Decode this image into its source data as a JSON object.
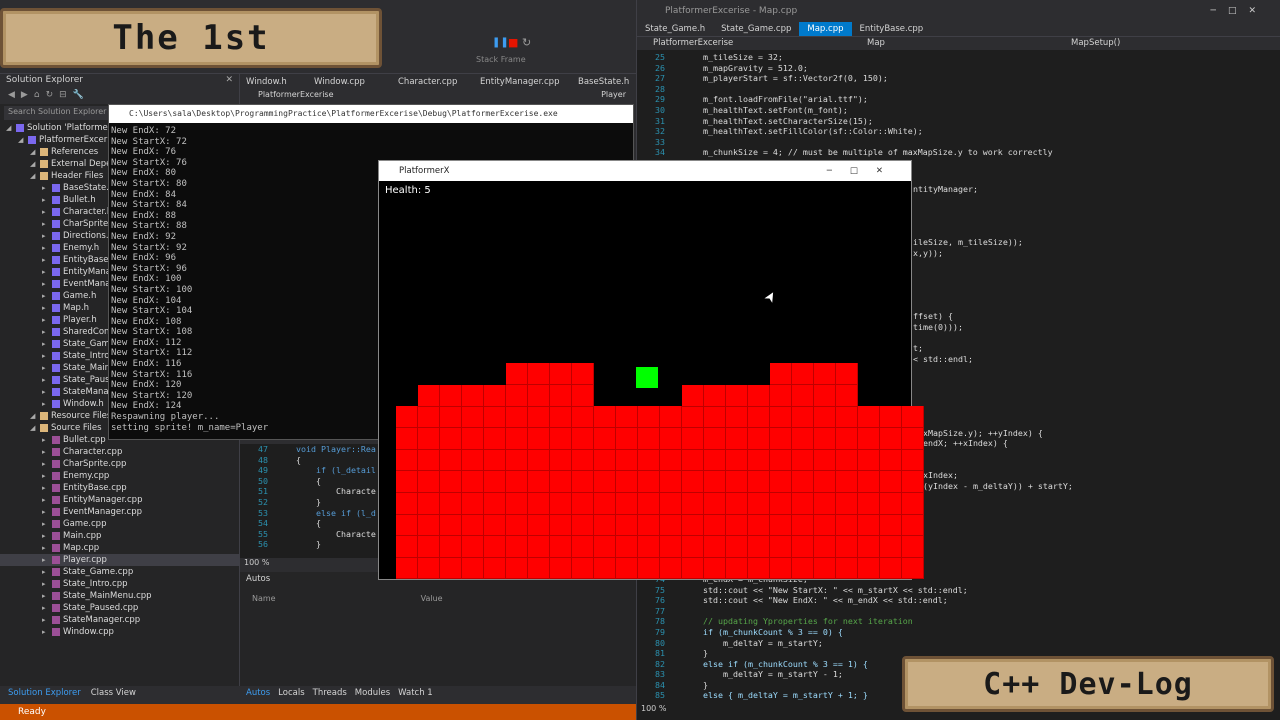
{
  "banners": {
    "left": "The 1st",
    "right": "C++ Dev-Log"
  },
  "left_ide": {
    "solution_explorer": {
      "title": "Solution Explorer",
      "search_placeholder": "Search Solution Explorer (Ctrl+;)",
      "items": [
        {
          "label": "Solution 'PlatformerExce'",
          "level": 0
        },
        {
          "label": "PlatformerExcerise",
          "level": 1
        },
        {
          "label": "References",
          "level": 2
        },
        {
          "label": "External Depend",
          "level": 2
        },
        {
          "label": "Header Files",
          "level": 2
        },
        {
          "label": "BaseState.h",
          "level": 3
        },
        {
          "label": "Bullet.h",
          "level": 3
        },
        {
          "label": "Character.h",
          "level": 3
        },
        {
          "label": "CharSprite.h",
          "level": 3
        },
        {
          "label": "Directions.h",
          "level": 3
        },
        {
          "label": "Enemy.h",
          "level": 3
        },
        {
          "label": "EntityBase.h",
          "level": 3
        },
        {
          "label": "EntityManag",
          "level": 3
        },
        {
          "label": "EventManage",
          "level": 3
        },
        {
          "label": "Game.h",
          "level": 3
        },
        {
          "label": "Map.h",
          "level": 3
        },
        {
          "label": "Player.h",
          "level": 3
        },
        {
          "label": "SharedConte",
          "level": 3
        },
        {
          "label": "State_Game.h",
          "level": 3
        },
        {
          "label": "State_Intro.h",
          "level": 3
        },
        {
          "label": "State_MainM",
          "level": 3
        },
        {
          "label": "State_Paused",
          "level": 3
        },
        {
          "label": "StateManage",
          "level": 3
        },
        {
          "label": "Window.h",
          "level": 3
        },
        {
          "label": "Resource Files",
          "level": 2
        },
        {
          "label": "Source Files",
          "level": 2
        },
        {
          "label": "Bullet.cpp",
          "level": 3
        },
        {
          "label": "Character.cpp",
          "level": 3
        },
        {
          "label": "CharSprite.cpp",
          "level": 3
        },
        {
          "label": "Enemy.cpp",
          "level": 3
        },
        {
          "label": "EntityBase.cpp",
          "level": 3
        },
        {
          "label": "EntityManager.cpp",
          "level": 3
        },
        {
          "label": "EventManager.cpp",
          "level": 3
        },
        {
          "label": "Game.cpp",
          "level": 3
        },
        {
          "label": "Main.cpp",
          "level": 3
        },
        {
          "label": "Map.cpp",
          "level": 3
        },
        {
          "label": "Player.cpp",
          "level": 3
        },
        {
          "label": "State_Game.cpp",
          "level": 3
        },
        {
          "label": "State_Intro.cpp",
          "level": 3
        },
        {
          "label": "State_MainMenu.cpp",
          "level": 3
        },
        {
          "label": "State_Paused.cpp",
          "level": 3
        },
        {
          "label": "StateManager.cpp",
          "level": 3
        },
        {
          "label": "Window.cpp",
          "level": 3
        }
      ],
      "tabs": [
        "Solution Explorer",
        "Class View"
      ]
    },
    "editor_tabs": [
      "Window.h",
      "Window.cpp",
      "Character.cpp",
      "EntityManager.cpp",
      "BaseState.h"
    ],
    "editor_nav": {
      "project": "PlatformerExcerise",
      "scope": "Player"
    },
    "stack_frame": "Stack Frame",
    "console": {
      "title": "C:\\Users\\sala\\Desktop\\ProgrammingPractice\\PlatformerExcerise\\Debug\\PlatformerExcerise.exe",
      "lines": [
        "New EndX: 72",
        "New StartX: 72",
        "New EndX: 76",
        "New StartX: 76",
        "New EndX: 80",
        "New StartX: 80",
        "New EndX: 84",
        "New StartX: 84",
        "New EndX: 88",
        "New StartX: 88",
        "New EndX: 92",
        "New StartX: 92",
        "New EndX: 96",
        "New StartX: 96",
        "New EndX: 100",
        "New StartX: 100",
        "New EndX: 104",
        "New StartX: 104",
        "New EndX: 108",
        "New StartX: 108",
        "New EndX: 112",
        "New StartX: 112",
        "New EndX: 116",
        "New StartX: 116",
        "New EndX: 120",
        "New StartX: 120",
        "New EndX: 124",
        "Respawning player...",
        "setting sprite! m_name=Player"
      ]
    },
    "mid_code": {
      "lines": [
        {
          "n": "47",
          "t": "void Player::Rea"
        },
        {
          "n": "48",
          "t": "{"
        },
        {
          "n": "49",
          "t": "    if (l_detail"
        },
        {
          "n": "50",
          "t": "    {"
        },
        {
          "n": "51",
          "t": "        Characte"
        },
        {
          "n": "52",
          "t": "    }"
        },
        {
          "n": "53",
          "t": "    else if (l_d"
        },
        {
          "n": "54",
          "t": "    {"
        },
        {
          "n": "55",
          "t": "        Characte"
        },
        {
          "n": "56",
          "t": "    }"
        }
      ],
      "zoom": "100 %"
    },
    "autos": {
      "title": "Autos",
      "columns": [
        "Name",
        "Value"
      ],
      "tabs": [
        "Autos",
        "Locals",
        "Threads",
        "Modules",
        "Watch 1"
      ]
    },
    "status": "Ready"
  },
  "right_ide": {
    "title": "PlatformerExcerise - Map.cpp",
    "tabs": [
      "State_Game.h",
      "State_Game.cpp",
      "Map.cpp",
      "EntityBase.cpp"
    ],
    "active_tab": "Map.cpp",
    "nav": {
      "project": "PlatformerExcerise",
      "scope": "Map",
      "member": "MapSetup()"
    },
    "zoom": "100 %",
    "code_top": [
      {
        "n": "25",
        "t": "m_tileSize = 32;"
      },
      {
        "n": "26",
        "t": "m_mapGravity = 512.0;"
      },
      {
        "n": "27",
        "t": "m_playerStart = sf::Vector2f(0, 150);"
      },
      {
        "n": "28",
        "t": ""
      },
      {
        "n": "29",
        "t": "m_font.loadFromFile(\"arial.ttf\");"
      },
      {
        "n": "30",
        "t": "m_healthText.setFont(m_font);"
      },
      {
        "n": "31",
        "t": "m_healthText.setCharacterSize(15);"
      },
      {
        "n": "32",
        "t": "m_healthText.setFillColor(sf::Color::White);"
      },
      {
        "n": "33",
        "t": ""
      },
      {
        "n": "34",
        "t": "m_chunkSize = 4; // must be multiple of maxMapSize.y to work correctly"
      }
    ],
    "code_fragments": [
      "ntityManager;",
      "ileSize, m_tileSize));",
      "x,y));",
      "ffset) {",
      "time(0)));",
      "t;",
      "< std::endl;",
      "MaxMapSize.y); ++yIndex) {",
      "m_endX; ++xIndex) {",
      "+ xIndex;",
      "+ (yIndex - m_deltaY)) + startY;"
    ],
    "code_bottom": [
      {
        "n": "74",
        "t": "m_endX = m_chunkSize;"
      },
      {
        "n": "75",
        "t": "std::cout << \"New StartX: \" << m_startX << std::endl;"
      },
      {
        "n": "76",
        "t": "std::cout << \"New EndX: \" << m_endX << std::endl;"
      },
      {
        "n": "77",
        "t": ""
      },
      {
        "n": "78",
        "t": "// updating Yproperties for next iteration"
      },
      {
        "n": "79",
        "t": "if (m_chunkCount % 3 == 0) {"
      },
      {
        "n": "80",
        "t": "    m_deltaY = m_startY;"
      },
      {
        "n": "81",
        "t": "}"
      },
      {
        "n": "82",
        "t": "else if (m_chunkCount % 3 == 1) {"
      },
      {
        "n": "83",
        "t": "    m_deltaY = m_startY - 1;"
      },
      {
        "n": "84",
        "t": "}"
      },
      {
        "n": "85",
        "t": "else { m_deltaY = m_startY + 1; }"
      }
    ]
  },
  "game_window": {
    "title": "PlatformerX",
    "health_text": "Health: 5",
    "colors": {
      "tile": "#ff0000",
      "player": "#00ff00",
      "background": "#000000"
    }
  }
}
